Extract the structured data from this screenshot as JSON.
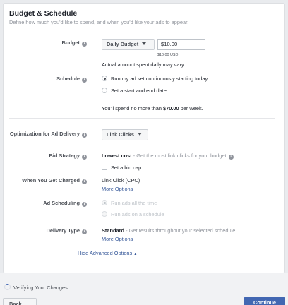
{
  "header": {
    "title": "Budget & Schedule",
    "subtitle": "Define how much you'd like to spend, and when you'd like your ads to appear."
  },
  "budget": {
    "label": "Budget",
    "type_selected": "Daily Budget",
    "amount_value": "$10.00",
    "amount_hint": "$10.00 USD",
    "note": "Actual amount spent daily may vary."
  },
  "schedule": {
    "label": "Schedule",
    "options": [
      "Run my ad set continuously starting today",
      "Set a start and end date"
    ],
    "summary_prefix": "You'll spend no more than ",
    "summary_amount": "$70.00",
    "summary_suffix": " per week."
  },
  "optimization": {
    "label": "Optimization for Ad Delivery",
    "selected": "Link Clicks"
  },
  "bid_strategy": {
    "label": "Bid Strategy",
    "value": "Lowest cost",
    "description": " - Get the most link clicks for your budget",
    "checkbox_label": "Set a bid cap"
  },
  "charged": {
    "label": "When You Get Charged",
    "value": "Link Click (CPC)",
    "more_options": "More Options"
  },
  "ad_scheduling": {
    "label": "Ad Scheduling",
    "options": [
      "Run ads all the time",
      "Run ads on a schedule"
    ]
  },
  "delivery_type": {
    "label": "Delivery Type",
    "value": "Standard",
    "description": " - Get results throughout your selected schedule",
    "more_options": "More Options"
  },
  "advanced": {
    "hide_label": "Hide Advanced Options"
  },
  "footer": {
    "status": "Verifying Your Changes",
    "back_label": "Back",
    "continue_label": "Continue"
  },
  "colors": {
    "accent": "#4267b2",
    "link": "#365899",
    "muted": "#90949c"
  }
}
